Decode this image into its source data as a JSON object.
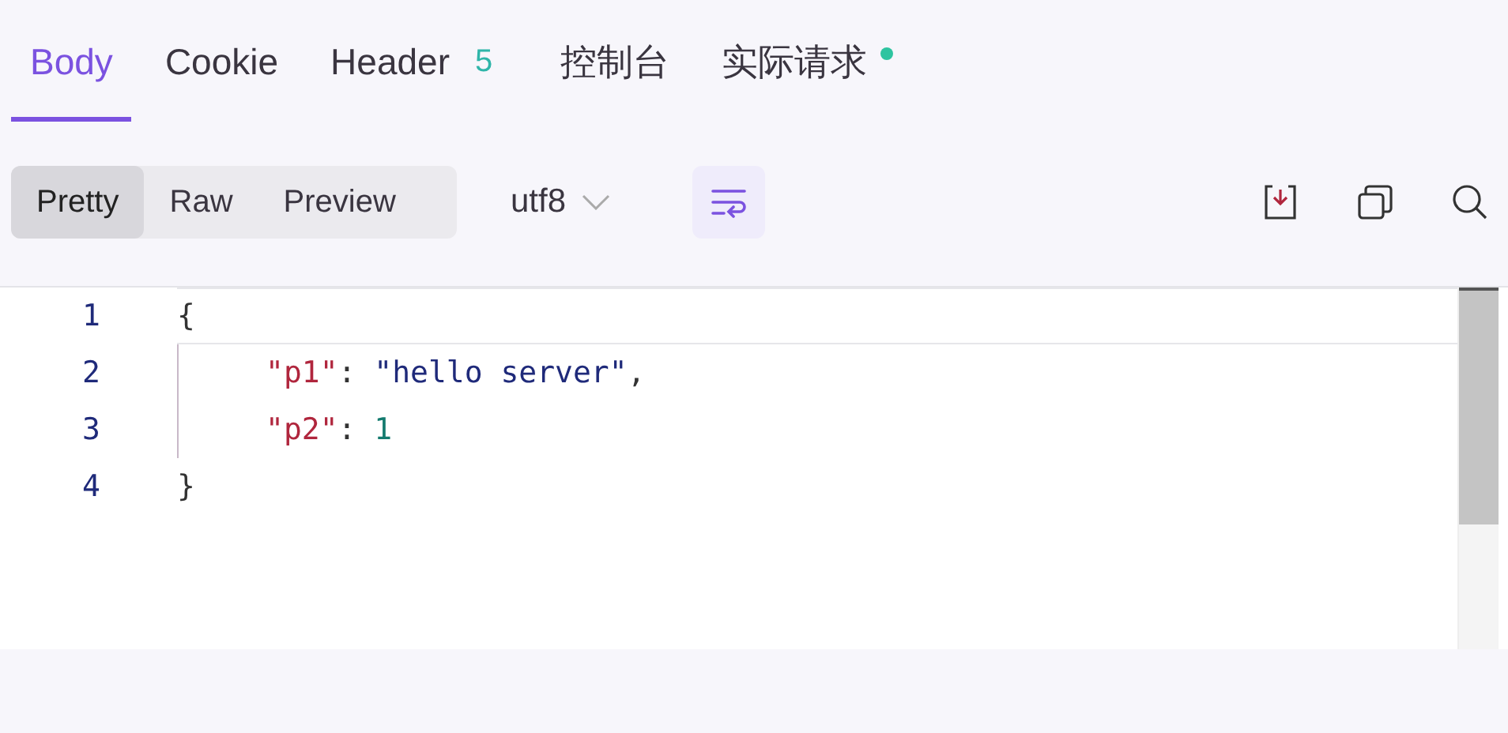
{
  "tabs": [
    {
      "label": "Body",
      "selected": true
    },
    {
      "label": "Cookie",
      "selected": false
    },
    {
      "label": "Header",
      "selected": false,
      "badge": "5"
    },
    {
      "label": "控制台",
      "selected": false
    },
    {
      "label": "实际请求",
      "selected": false,
      "dot": true
    }
  ],
  "view_modes": [
    {
      "label": "Pretty",
      "selected": true
    },
    {
      "label": "Raw",
      "selected": false
    },
    {
      "label": "Preview",
      "selected": false
    }
  ],
  "encoding": "utf8",
  "wrap": {
    "on": true
  },
  "editor": {
    "lines": [
      {
        "number": "1",
        "indented": false,
        "active": true,
        "tokens": [
          {
            "kind": "punct",
            "text": "{"
          }
        ]
      },
      {
        "number": "2",
        "indented": true,
        "active": false,
        "tokens": [
          {
            "kind": "key",
            "text": "\"p1\""
          },
          {
            "kind": "punct",
            "text": ": "
          },
          {
            "kind": "string",
            "text": "\"hello server\""
          },
          {
            "kind": "punct",
            "text": ","
          }
        ]
      },
      {
        "number": "3",
        "indented": true,
        "active": false,
        "tokens": [
          {
            "kind": "key",
            "text": "\"p2\""
          },
          {
            "kind": "punct",
            "text": ": "
          },
          {
            "kind": "number",
            "text": "1"
          }
        ]
      },
      {
        "number": "4",
        "indented": false,
        "active": false,
        "tokens": [
          {
            "kind": "punct",
            "text": "}"
          }
        ]
      }
    ]
  }
}
